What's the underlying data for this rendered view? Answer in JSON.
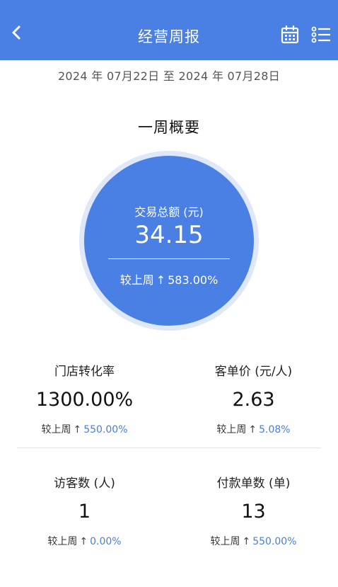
{
  "header": {
    "title": "经营周报",
    "back_icon": "chevron-left-icon",
    "calendar_icon": "calendar-icon",
    "list_icon": "list-icon",
    "color": "#4a80e4"
  },
  "date_range": "2024 年 07月22日 至 2024 年 07月28日",
  "summary": {
    "title": "一周概要",
    "total": {
      "label": "交易总额 (元)",
      "value": "34.15",
      "compare_label": "较上周",
      "compare_value": "583.00%"
    }
  },
  "metrics": [
    {
      "label": "门店转化率",
      "value": "1300.00%",
      "compare_label": "较上周",
      "compare_value": "550.00%"
    },
    {
      "label": "客单价 (元/人)",
      "value": "2.63",
      "compare_label": "较上周",
      "compare_value": "5.08%"
    },
    {
      "label": "访客数 (人)",
      "value": "1",
      "compare_label": "较上周",
      "compare_value": "0.00%"
    },
    {
      "label": "付款单数 (单)",
      "value": "13",
      "compare_label": "较上周",
      "compare_value": "550.00%"
    }
  ]
}
